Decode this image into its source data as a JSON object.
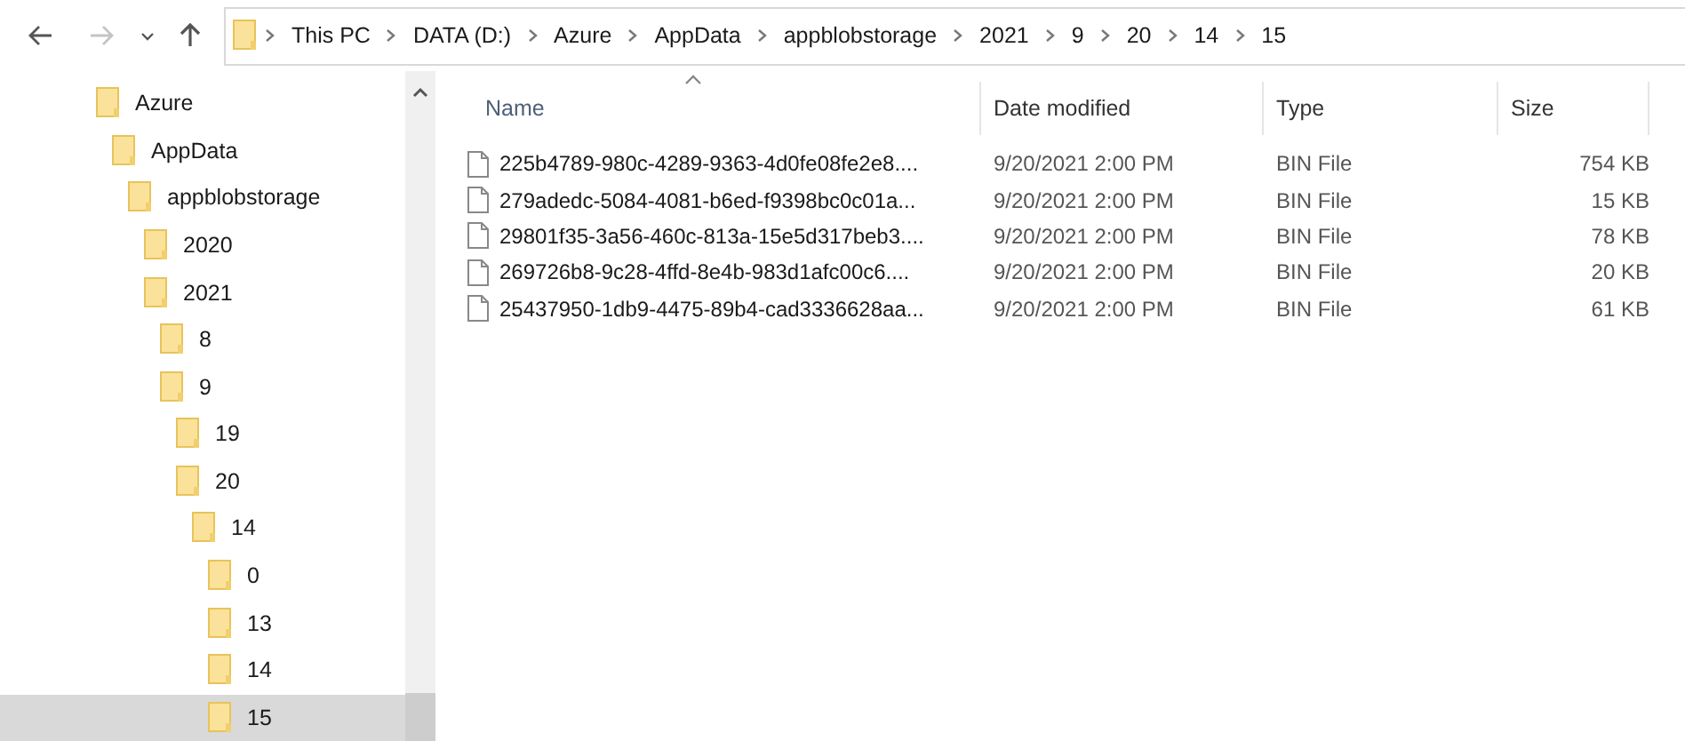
{
  "nav_buttons": [
    {
      "kind": "back",
      "disabled": false
    },
    {
      "kind": "forward",
      "disabled": true
    },
    {
      "kind": "recent",
      "disabled": false
    },
    {
      "kind": "up",
      "disabled": false
    }
  ],
  "address_bar": {
    "path": [
      "This PC",
      "DATA (D:)",
      "Azure",
      "AppData",
      "appblobstorage",
      "2021",
      "9",
      "20",
      "14",
      "15"
    ]
  },
  "sidebar": {
    "items": [
      {
        "label": "Azure",
        "selected": false,
        "children": [
          {
            "label": "AppData",
            "selected": false,
            "children": [
              {
                "label": "appblobstorage",
                "selected": false,
                "children": [
                  {
                    "label": "2020",
                    "selected": false
                  },
                  {
                    "label": "2021",
                    "selected": false,
                    "children": [
                      {
                        "label": "8",
                        "selected": false
                      },
                      {
                        "label": "9",
                        "selected": false,
                        "children": [
                          {
                            "label": "19",
                            "selected": false
                          },
                          {
                            "label": "20",
                            "selected": false,
                            "children": [
                              {
                                "label": "14",
                                "selected": false,
                                "children": [
                                  {
                                    "label": "0",
                                    "selected": false
                                  },
                                  {
                                    "label": "13",
                                    "selected": false
                                  },
                                  {
                                    "label": "14",
                                    "selected": false
                                  },
                                  {
                                    "label": "15",
                                    "selected": true
                                  }
                                ]
                              }
                            ]
                          }
                        ]
                      }
                    ]
                  }
                ]
              }
            ]
          }
        ]
      }
    ]
  },
  "table": {
    "columns": [
      {
        "label": "Name",
        "sorted": true
      },
      {
        "label": "Date modified",
        "sorted": false
      },
      {
        "label": "Type",
        "sorted": false
      },
      {
        "label": "Size",
        "sorted": false
      }
    ],
    "rows": [
      {
        "name": "225b4789-980c-4289-9363-4d0fe08fe2e8....",
        "date": "9/20/2021 2:00 PM",
        "type": "BIN File",
        "size": "754 KB"
      },
      {
        "name": "279adedc-5084-4081-b6ed-f9398bc0c01a...",
        "date": "9/20/2021 2:00 PM",
        "type": "BIN File",
        "size": "15 KB"
      },
      {
        "name": "29801f35-3a56-460c-813a-15e5d317beb3....",
        "date": "9/20/2021 2:00 PM",
        "type": "BIN File",
        "size": "78 KB"
      },
      {
        "name": "269726b8-9c28-4ffd-8e4b-983d1afc00c6....",
        "date": "9/20/2021 2:00 PM",
        "type": "BIN File",
        "size": "20 KB"
      },
      {
        "name": "25437950-1db9-4475-89b4-cad3336628aa...",
        "date": "9/20/2021 2:00 PM",
        "type": "BIN File",
        "size": "61 KB"
      }
    ]
  }
}
